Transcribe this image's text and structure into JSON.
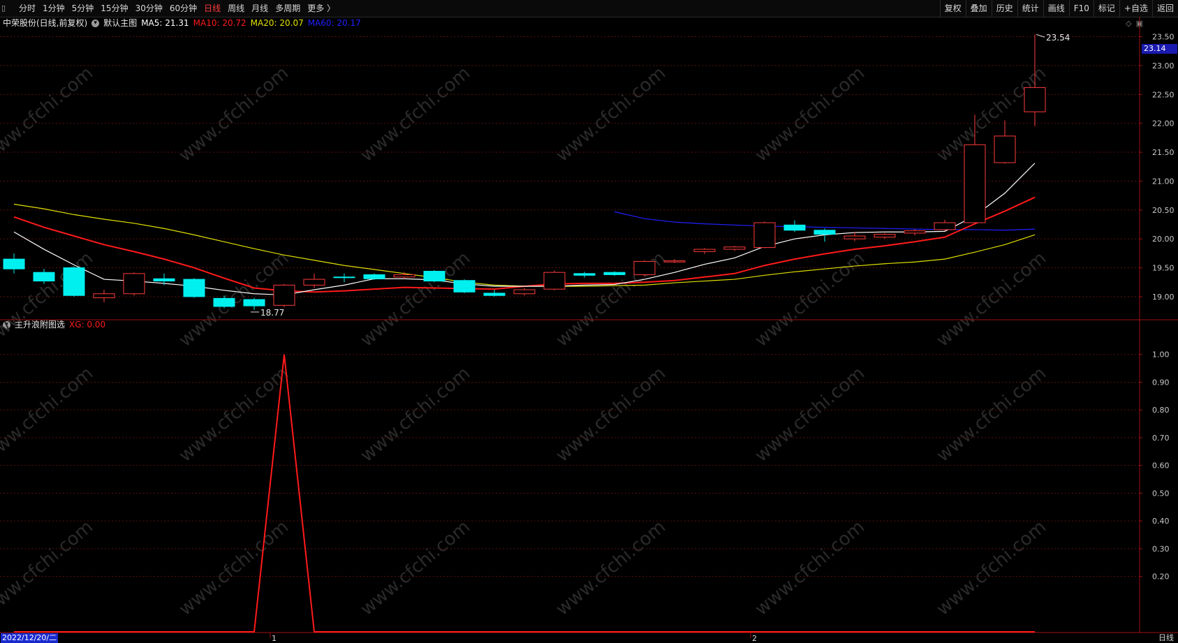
{
  "toolbar": {
    "periods": [
      "分时",
      "1分钟",
      "5分钟",
      "15分钟",
      "30分钟",
      "60分钟",
      "日线",
      "周线",
      "月线",
      "多周期",
      "更多 〉"
    ],
    "active_period": "日线",
    "right_buttons": [
      "复权",
      "叠加",
      "历史",
      "统计",
      "画线",
      "F10",
      "标记",
      "+自选",
      "返回"
    ]
  },
  "main_panel": {
    "stock_title": "中荣股份(日线,前复权)",
    "template": "默认主图",
    "ma5": "MA5: 21.31",
    "ma10": "MA10: 20.72",
    "ma20": "MA20: 20.07",
    "ma60": "MA60: 20.17",
    "high_label": "23.54",
    "low_label": "18.77",
    "current_price": "23.14",
    "y_ticks": [
      "23.50",
      "23.00",
      "22.50",
      "22.00",
      "21.50",
      "21.00",
      "20.50",
      "20.00",
      "19.50",
      "19.00"
    ]
  },
  "sub_panel": {
    "indicator_name": "主升浪附图选",
    "xg_label": "XG: 0.00",
    "y_ticks": [
      "1.00",
      "0.90",
      "0.80",
      "0.70",
      "0.60",
      "0.50",
      "0.40",
      "0.30",
      "0.20"
    ]
  },
  "x_axis": {
    "start_date": "2022/12/20/二",
    "month_marks": [
      "1",
      "2"
    ],
    "period_label": "日线"
  },
  "watermark": "www.cfchi.com",
  "colors": {
    "up": "#ff3b3b",
    "down": "#00f0f0",
    "ma5": "#ffffff",
    "ma10": "#ff1a1a",
    "ma20": "#e0e000",
    "ma60": "#2020ff",
    "grid": "#5a1010",
    "border": "#a01010"
  },
  "chart_data": {
    "type": "candlestick",
    "candles": [
      {
        "o": 19.65,
        "c": 19.48,
        "h": 19.75,
        "l": 19.4
      },
      {
        "o": 19.42,
        "c": 19.27,
        "h": 19.48,
        "l": 19.22
      },
      {
        "o": 19.5,
        "c": 19.02,
        "h": 19.52,
        "l": 19.0
      },
      {
        "o": 18.98,
        "c": 19.05,
        "h": 19.12,
        "l": 18.9
      },
      {
        "o": 19.05,
        "c": 19.4,
        "h": 19.42,
        "l": 19.02
      },
      {
        "o": 19.31,
        "c": 19.27,
        "h": 19.4,
        "l": 19.2
      },
      {
        "o": 19.3,
        "c": 19.0,
        "h": 19.32,
        "l": 18.98
      },
      {
        "o": 18.97,
        "c": 18.83,
        "h": 19.02,
        "l": 18.8
      },
      {
        "o": 18.95,
        "c": 18.84,
        "h": 18.98,
        "l": 18.77
      },
      {
        "o": 18.85,
        "c": 19.2,
        "h": 19.22,
        "l": 18.82
      },
      {
        "o": 19.2,
        "c": 19.3,
        "h": 19.4,
        "l": 19.15
      },
      {
        "o": 19.34,
        "c": 19.33,
        "h": 19.4,
        "l": 19.25
      },
      {
        "o": 19.38,
        "c": 19.31,
        "h": 19.4,
        "l": 19.29
      },
      {
        "o": 19.34,
        "c": 19.38,
        "h": 19.43,
        "l": 19.31
      },
      {
        "o": 19.44,
        "c": 19.27,
        "h": 19.46,
        "l": 19.25
      },
      {
        "o": 19.28,
        "c": 19.08,
        "h": 19.3,
        "l": 19.06
      },
      {
        "o": 19.06,
        "c": 19.02,
        "h": 19.12,
        "l": 19.0
      },
      {
        "o": 19.05,
        "c": 19.12,
        "h": 19.15,
        "l": 19.02
      },
      {
        "o": 19.13,
        "c": 19.42,
        "h": 19.45,
        "l": 19.11
      },
      {
        "o": 19.4,
        "c": 19.37,
        "h": 19.43,
        "l": 19.33
      },
      {
        "o": 19.42,
        "c": 19.38,
        "h": 19.44,
        "l": 19.36
      },
      {
        "o": 19.38,
        "c": 19.61,
        "h": 19.63,
        "l": 19.35
      },
      {
        "o": 19.6,
        "c": 19.62,
        "h": 19.65,
        "l": 19.58
      },
      {
        "o": 19.78,
        "c": 19.82,
        "h": 19.84,
        "l": 19.74
      },
      {
        "o": 19.82,
        "c": 19.86,
        "h": 19.88,
        "l": 19.79
      },
      {
        "o": 19.85,
        "c": 20.28,
        "h": 20.3,
        "l": 19.84
      },
      {
        "o": 20.24,
        "c": 20.15,
        "h": 20.32,
        "l": 20.12
      },
      {
        "o": 20.15,
        "c": 20.08,
        "h": 20.18,
        "l": 19.95
      },
      {
        "o": 20.0,
        "c": 20.05,
        "h": 20.12,
        "l": 19.96
      },
      {
        "o": 20.03,
        "c": 20.08,
        "h": 20.1,
        "l": 20.0
      },
      {
        "o": 20.1,
        "c": 20.14,
        "h": 20.17,
        "l": 20.06
      },
      {
        "o": 20.16,
        "c": 20.28,
        "h": 20.33,
        "l": 20.14
      },
      {
        "o": 20.28,
        "c": 21.63,
        "h": 22.15,
        "l": 20.26
      },
      {
        "o": 21.32,
        "c": 21.78,
        "h": 22.05,
        "l": 21.3
      },
      {
        "o": 22.2,
        "c": 22.62,
        "h": 23.54,
        "l": 21.95
      }
    ],
    "ma5": [
      20.12,
      19.82,
      19.55,
      19.3,
      19.27,
      19.23,
      19.18,
      19.11,
      19.05,
      19.03,
      19.12,
      19.2,
      19.31,
      19.31,
      19.29,
      19.22,
      19.18,
      19.18,
      19.18,
      19.2,
      19.21,
      19.3,
      19.42,
      19.56,
      19.67,
      19.87,
      20.0,
      20.07,
      20.11,
      20.12,
      20.12,
      20.13,
      20.4,
      20.79,
      21.31
    ],
    "ma10": [
      20.38,
      20.2,
      20.05,
      19.9,
      19.78,
      19.65,
      19.5,
      19.32,
      19.15,
      19.1,
      19.08,
      19.1,
      19.13,
      19.16,
      19.15,
      19.14,
      19.13,
      19.18,
      19.22,
      19.23,
      19.23,
      19.25,
      19.28,
      19.34,
      19.4,
      19.54,
      19.65,
      19.74,
      19.82,
      19.88,
      19.95,
      20.03,
      20.26,
      20.48,
      20.72
    ],
    "ma20": [
      20.6,
      20.52,
      20.42,
      20.34,
      20.27,
      20.18,
      20.07,
      19.95,
      19.83,
      19.72,
      19.63,
      19.54,
      19.47,
      19.4,
      19.33,
      19.25,
      19.2,
      19.18,
      19.18,
      19.18,
      19.19,
      19.2,
      19.24,
      19.27,
      19.3,
      19.37,
      19.43,
      19.48,
      19.53,
      19.57,
      19.6,
      19.65,
      19.77,
      19.9,
      20.07
    ],
    "ma60": [
      null,
      null,
      null,
      null,
      null,
      null,
      null,
      null,
      null,
      null,
      null,
      null,
      null,
      null,
      null,
      null,
      null,
      null,
      null,
      null,
      20.47,
      20.35,
      20.29,
      20.26,
      20.24,
      20.22,
      20.21,
      20.2,
      20.19,
      20.18,
      20.17,
      20.16,
      20.16,
      20.15,
      20.17
    ],
    "xg": [
      0,
      0,
      0,
      0,
      0,
      0,
      0,
      0,
      0,
      1,
      0,
      0,
      0,
      0,
      0,
      0,
      0,
      0,
      0,
      0,
      0,
      0,
      0,
      0,
      0,
      0,
      0,
      0,
      0,
      0,
      0,
      0,
      0,
      0,
      0
    ],
    "main_ylim": [
      18.6,
      23.7
    ],
    "sub_ylim": [
      0,
      1.1
    ]
  }
}
